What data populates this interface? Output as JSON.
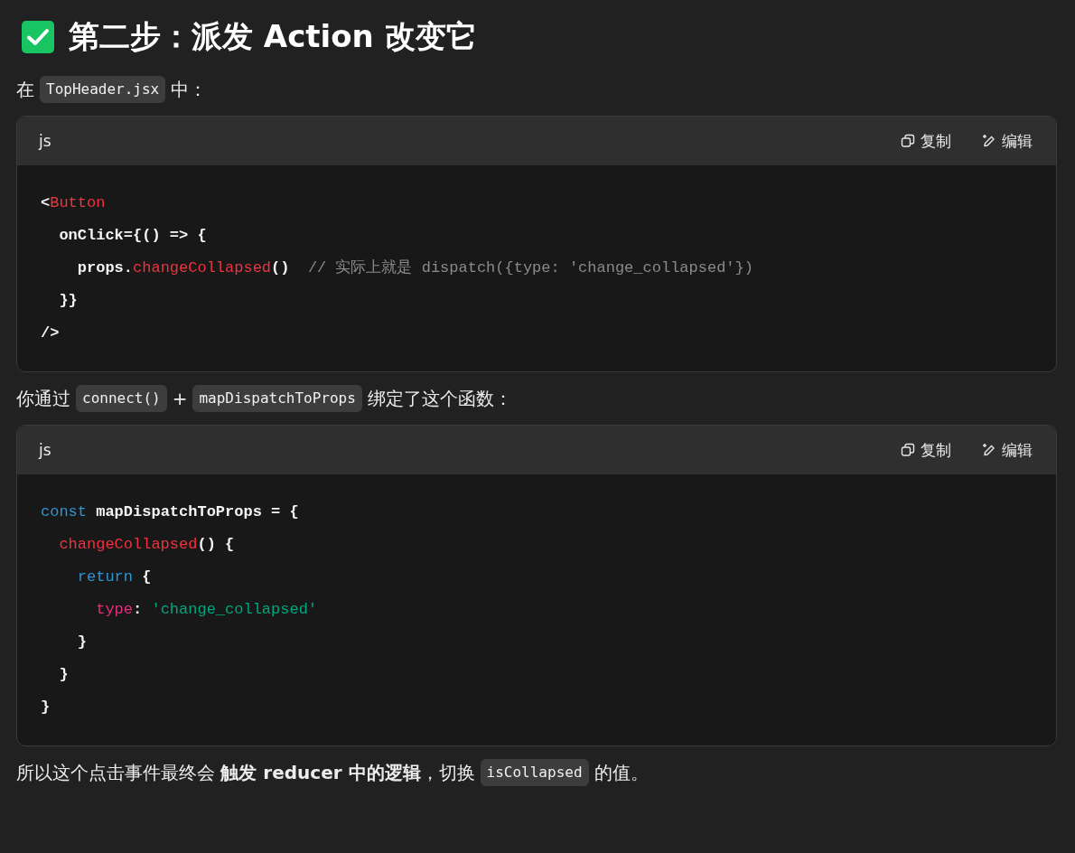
{
  "heading": {
    "text": "第二步：派发 Action 改变它"
  },
  "blocks": [
    {
      "kind": "paragraph",
      "parts": [
        {
          "kind": "text",
          "s": "在"
        },
        {
          "kind": "code",
          "s": "TopHeader.jsx"
        },
        {
          "kind": "text",
          "s": "中："
        }
      ]
    },
    {
      "kind": "code",
      "language": "js",
      "actions": [
        {
          "kind": "copy",
          "label": "复制"
        },
        {
          "kind": "edit",
          "label": "编辑"
        }
      ],
      "lines": [
        [
          {
            "kind": "plain",
            "s": "<"
          },
          {
            "kind": "red",
            "s": "Button"
          }
        ],
        [
          {
            "kind": "plain",
            "s": "  onClick={() => {"
          }
        ],
        [
          {
            "kind": "plain",
            "s": "    props."
          },
          {
            "kind": "red",
            "s": "changeCollapsed"
          },
          {
            "kind": "plain",
            "s": "()  "
          },
          {
            "kind": "comment",
            "s": "// 实际上就是 dispatch({type: 'change_collapsed'})"
          }
        ],
        [
          {
            "kind": "plain",
            "s": "  }}"
          }
        ],
        [
          {
            "kind": "plain",
            "s": "/>"
          }
        ]
      ]
    },
    {
      "kind": "paragraph",
      "parts": [
        {
          "kind": "text",
          "s": "你通过"
        },
        {
          "kind": "code",
          "s": "connect()"
        },
        {
          "kind": "text",
          "s": "+"
        },
        {
          "kind": "code",
          "s": "mapDispatchToProps"
        },
        {
          "kind": "text",
          "s": "绑定了这个函数："
        }
      ]
    },
    {
      "kind": "code",
      "language": "js",
      "actions": [
        {
          "kind": "copy",
          "label": "复制"
        },
        {
          "kind": "edit",
          "label": "编辑"
        }
      ],
      "lines": [
        [
          {
            "kind": "blue",
            "s": "const"
          },
          {
            "kind": "plain",
            "s": " mapDispatchToProps = {"
          }
        ],
        [
          {
            "kind": "red",
            "s": "  changeCollapsed"
          },
          {
            "kind": "plain",
            "s": "() {"
          }
        ],
        [
          {
            "kind": "blue",
            "s": "    return"
          },
          {
            "kind": "plain",
            "s": " {"
          }
        ],
        [
          {
            "kind": "pink",
            "s": "      type"
          },
          {
            "kind": "plain",
            "s": ": "
          },
          {
            "kind": "green",
            "s": "'change_collapsed'"
          }
        ],
        [
          {
            "kind": "plain",
            "s": "    }"
          }
        ],
        [
          {
            "kind": "plain",
            "s": "  }"
          }
        ],
        [
          {
            "kind": "plain",
            "s": "}"
          }
        ]
      ]
    },
    {
      "kind": "paragraph",
      "parts": [
        {
          "kind": "text",
          "s": "所以这个点击事件最终会 **触发 reducer 中的逻辑**，切换"
        },
        {
          "kind": "code",
          "s": "isCollapsed"
        },
        {
          "kind": "text",
          "s": "的值。"
        }
      ]
    }
  ]
}
